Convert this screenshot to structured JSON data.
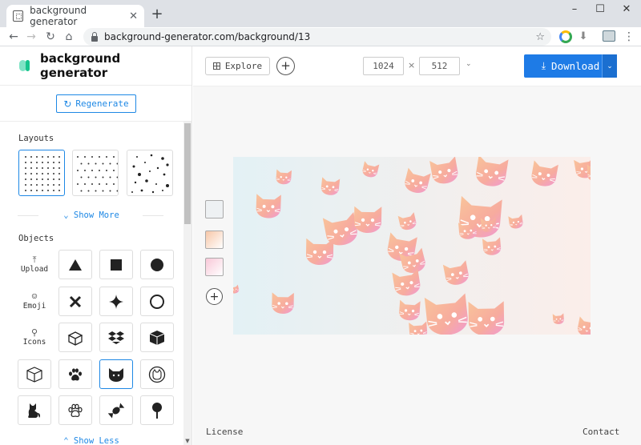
{
  "browser": {
    "tab_title": "background generator",
    "new_tab": "+",
    "url": "background-generator.com/background/13",
    "window_controls": {
      "minimize": "–",
      "maximize": "☐",
      "close": "✕"
    }
  },
  "sidebar": {
    "brand": "background generator",
    "regenerate_label": "Regenerate",
    "layouts_label": "Layouts",
    "show_more_label": "Show More",
    "objects_label": "Objects",
    "upload_label": "Upload",
    "emoji_label": "Emoji",
    "icons_label": "Icons",
    "show_less_label": "Show Less"
  },
  "topbar": {
    "explore_label": "Explore",
    "width_value": "1024",
    "height_value": "512",
    "times": "×",
    "download_label": "Download"
  },
  "palette": {
    "colors": [
      "#eef1f3",
      "#f7c7a8",
      "#f9c8d8"
    ]
  },
  "footer": {
    "license_label": "License",
    "contact_label": "Contact"
  },
  "colors": {
    "accent": "#1e7be6",
    "cat_peach": "#f8b49a",
    "cat_pink": "#f29ad0"
  }
}
